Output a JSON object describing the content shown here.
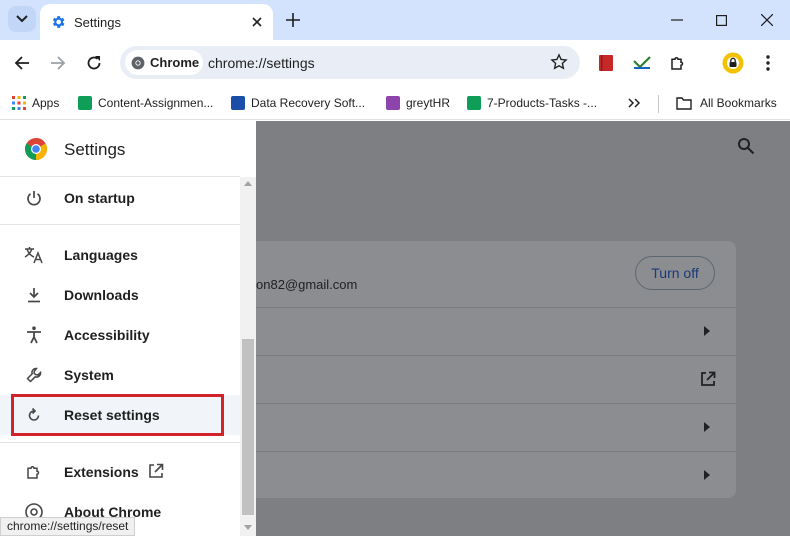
{
  "tab": {
    "title": "Settings"
  },
  "toolbar": {
    "chip_label": "Chrome",
    "url": "chrome://settings"
  },
  "bookmarks": [
    {
      "label": "Apps",
      "color": "#e34133"
    },
    {
      "label": "Content-Assignmen...",
      "color": "#0f9d58"
    },
    {
      "label": "Data Recovery Soft...",
      "color": "#1a4ea8"
    },
    {
      "label": "greytHR",
      "color": "#8e44ad"
    },
    {
      "label": "7-Products-Tasks -...",
      "color": "#0f9d58"
    }
  ],
  "all_bookmarks": "All Bookmarks",
  "sidebar": {
    "title": "Settings",
    "items": [
      {
        "label": "On startup",
        "icon": "power-icon"
      },
      {
        "label": "Languages",
        "icon": "translate-icon"
      },
      {
        "label": "Downloads",
        "icon": "download-icon"
      },
      {
        "label": "Accessibility",
        "icon": "accessibility-icon"
      },
      {
        "label": "System",
        "icon": "wrench-icon"
      },
      {
        "label": "Reset settings",
        "icon": "reset-icon"
      },
      {
        "label": "Extensions",
        "icon": "extension-icon"
      },
      {
        "label": "About Chrome",
        "icon": "chrome-icon"
      }
    ]
  },
  "main": {
    "email_partial": "on82@gmail.com",
    "turn_off_label": "Turn off"
  },
  "status_bar": "chrome://settings/reset",
  "colors": {
    "highlight": "#d1232a",
    "accent": "#1a73e8",
    "tabstrip": "#d3e3fd"
  }
}
